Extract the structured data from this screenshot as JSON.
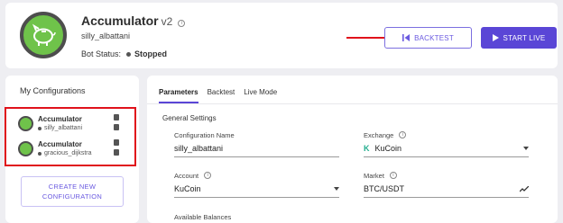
{
  "header": {
    "title": "Accumulator",
    "version": "v2",
    "username": "silly_albattani",
    "status_label": "Bot Status:",
    "status_value": "Stopped",
    "backtest_label": "BACKTEST",
    "start_label": "START LIVE",
    "accent": "#5a46d6",
    "annotation_color": "#e0121b"
  },
  "sidebar": {
    "title": "My Configurations",
    "items": [
      {
        "name": "Accumulator",
        "user": "silly_albattani"
      },
      {
        "name": "Accumulator",
        "user": "gracious_dijkstra"
      }
    ],
    "create_line1": "CREATE NEW",
    "create_line2": "CONFIGURATION"
  },
  "main": {
    "tabs": [
      {
        "label": "Parameters",
        "active": true
      },
      {
        "label": "Backtest",
        "active": false
      },
      {
        "label": "Live Mode",
        "active": false
      }
    ],
    "section_title": "General Settings",
    "fields": {
      "config_name": {
        "label": "Configuration Name",
        "value": "silly_albattani"
      },
      "exchange": {
        "label": "Exchange",
        "value": "KuCoin"
      },
      "account": {
        "label": "Account",
        "value": "KuCoin"
      },
      "market": {
        "label": "Market",
        "value": "BTC/USDT"
      }
    },
    "available_balances": "Available Balances"
  }
}
